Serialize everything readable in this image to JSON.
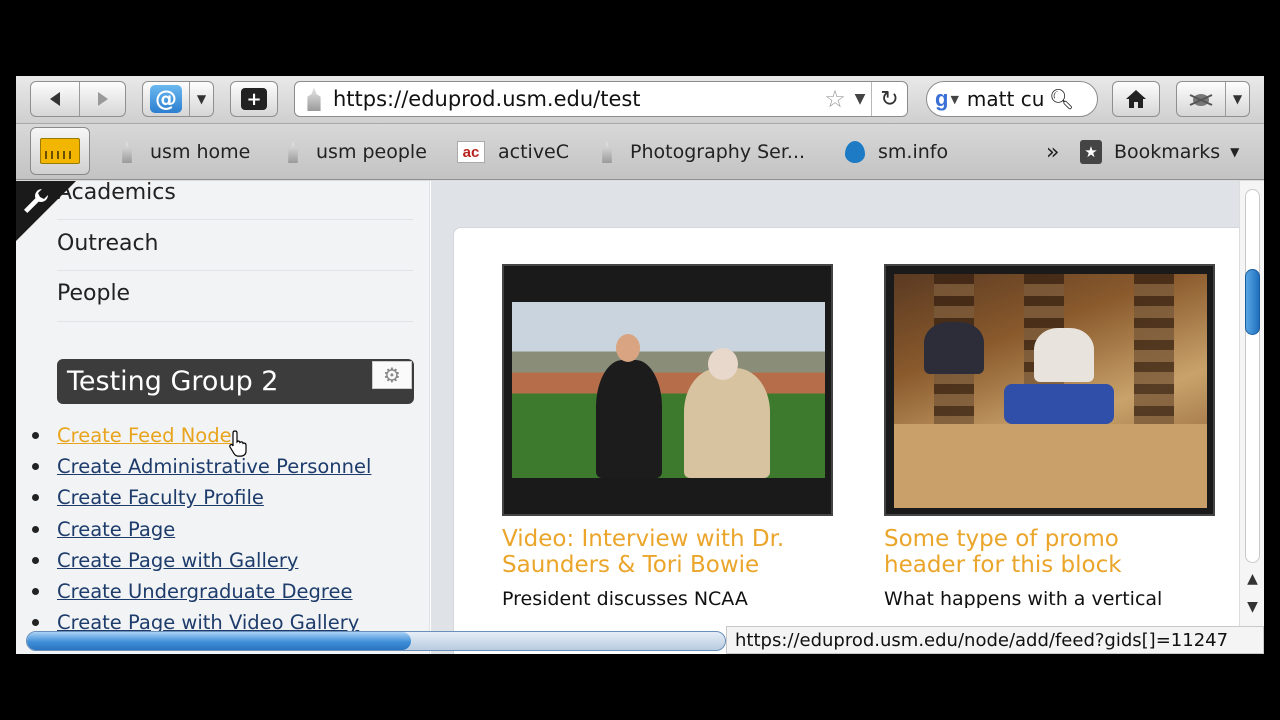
{
  "toolbar": {
    "back_icon": "back-arrow-icon",
    "forward_icon": "forward-arrow-icon",
    "addon_icon": "a-icon",
    "new_tab_icon": "plus-icon",
    "url": "https://eduprod.usm.edu/test",
    "search_engine": "Google",
    "search_value": "matt cu",
    "home_icon": "home-icon",
    "bug_icon": "bug-icon"
  },
  "bookmarks": {
    "items": [
      {
        "label": "usm home",
        "icon": "cathedral-icon"
      },
      {
        "label": "usm people",
        "icon": "cathedral-icon"
      },
      {
        "label": "activeC",
        "icon": "ac-logo-icon"
      },
      {
        "label": "Photography Ser...",
        "icon": "cathedral-icon"
      },
      {
        "label": "sm.info",
        "icon": "drupal-drop-icon"
      }
    ],
    "overflow_label": "»",
    "menu_label": "Bookmarks"
  },
  "sidebar": {
    "menu": [
      "Academics",
      "Outreach",
      "People"
    ],
    "block_title": "Testing Group 2",
    "links": [
      "Create Feed Node",
      "Create Administrative Personnel",
      "Create Faculty Profile",
      "Create Page",
      "Create Page with Gallery",
      "Create Undergraduate Degree",
      "Create Page with Video Gallery"
    ]
  },
  "content": {
    "cards": [
      {
        "title": "Video: Interview with Dr. Saunders & Tori Bowie",
        "text": "President discusses NCAA"
      },
      {
        "title": "Some type of promo header for this block",
        "text": "What happens with a vertical"
      }
    ]
  },
  "status": {
    "url": "https://eduprod.usm.edu/node/add/feed?gids[]=11247",
    "progress": 0.55
  },
  "colors": {
    "accent_link": "#1d3c6b",
    "active_link": "#e8a41c",
    "card_title": "#eaa52a"
  }
}
